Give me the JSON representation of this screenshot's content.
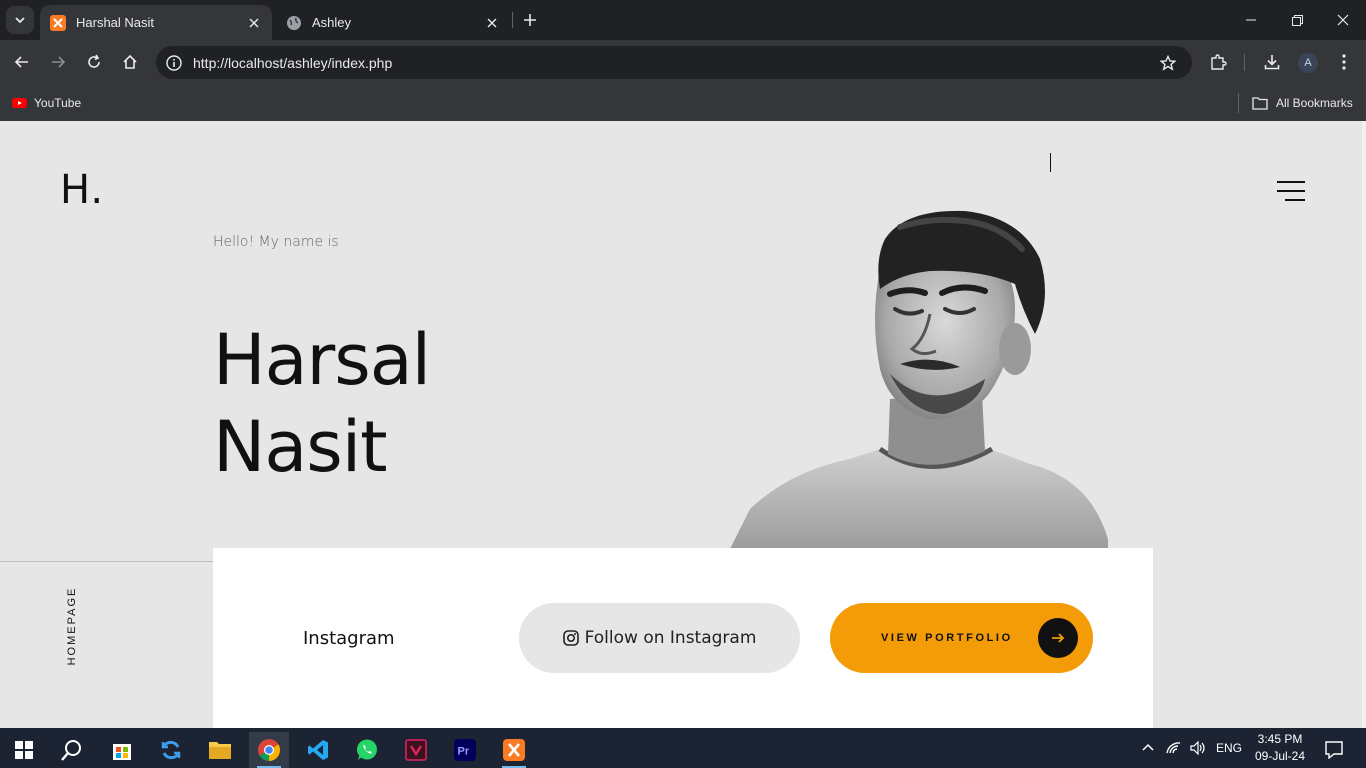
{
  "browser": {
    "tabs": [
      {
        "title": "Harshal Nasit",
        "active": true
      },
      {
        "title": "Ashley",
        "active": false
      }
    ],
    "url": "http://localhost/ashley/index.php",
    "profile_initial": "A",
    "bookmarks": [
      {
        "label": "YouTube"
      }
    ],
    "all_bookmarks_label": "All Bookmarks"
  },
  "page": {
    "logo": "H.",
    "intro": "Hello! My name is",
    "name_line1": "Harsal",
    "name_line2": "Nasit",
    "side_label": "HOMEPAGE",
    "card": {
      "label": "Instagram",
      "follow_label": "Follow on Instagram",
      "portfolio_label": "VIEW PORTFOLIO"
    },
    "colors": {
      "background": "#e6e6e6",
      "accent": "#f39c07",
      "text": "#111111"
    }
  },
  "taskbar": {
    "apps": [
      "start-icon",
      "search-icon",
      "store-icon",
      "sync-icon",
      "file-explorer-icon",
      "chrome-icon",
      "vscode-icon",
      "whatsapp-icon",
      "media-icon",
      "premiere-icon",
      "xampp-icon"
    ],
    "language": "ENG",
    "time": "3:45 PM",
    "date": "09-Jul-24"
  }
}
